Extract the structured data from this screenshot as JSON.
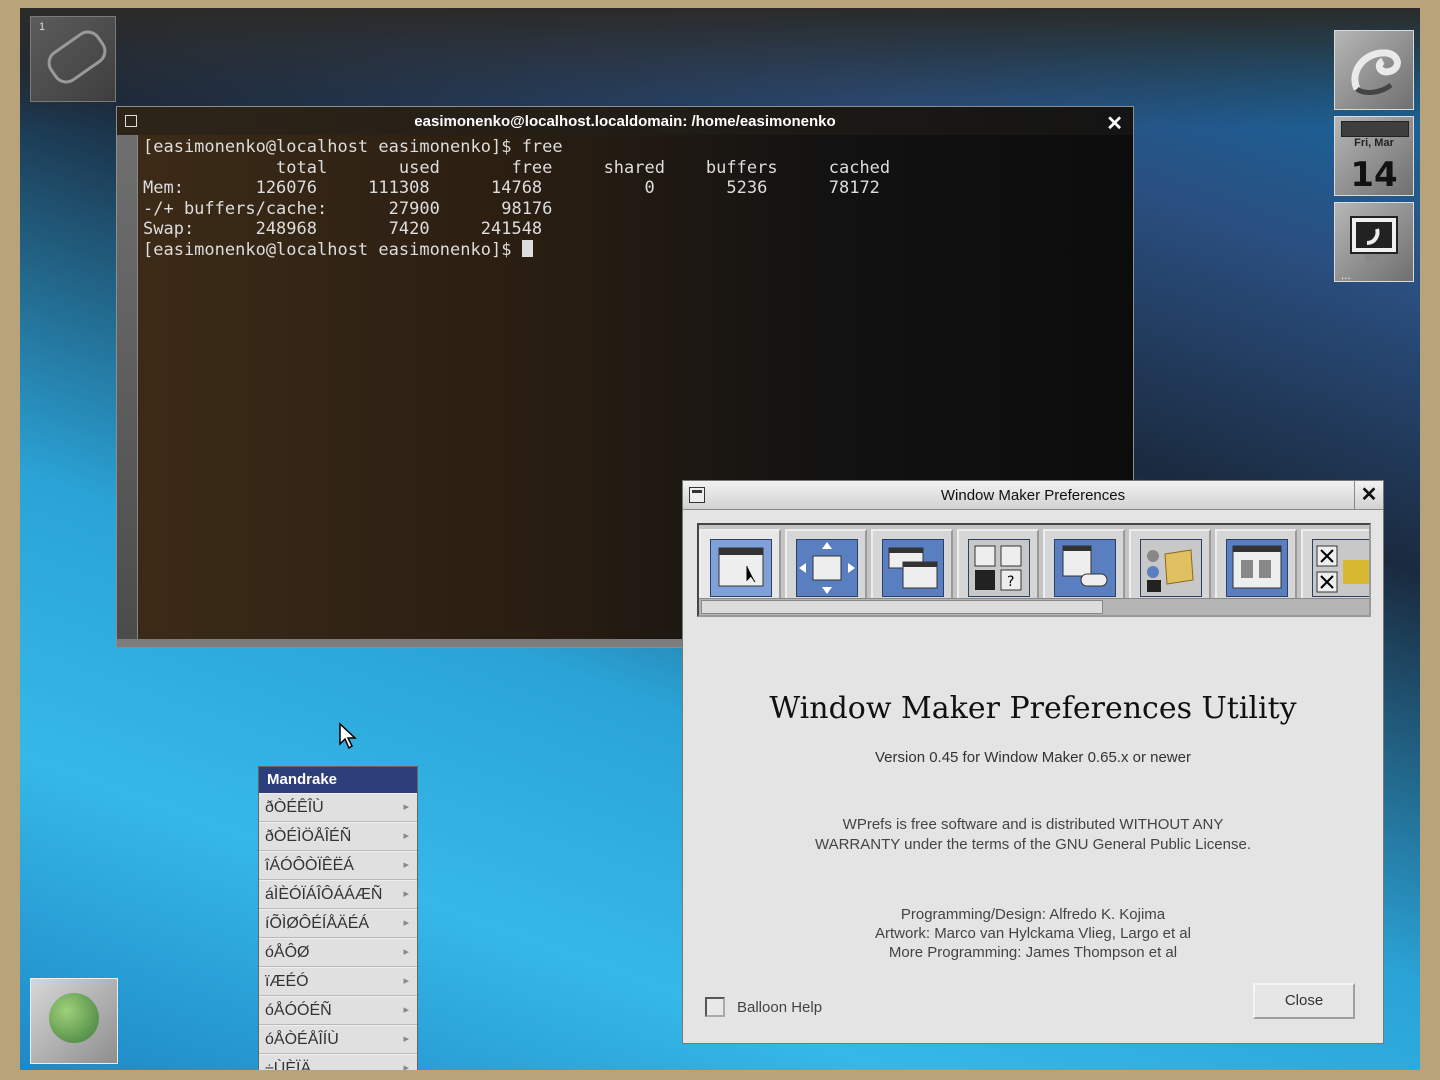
{
  "terminal": {
    "title": "easimonenko@localhost.localdomain: /home/easimonenko",
    "close_label": "✕",
    "lines": [
      "[easimonenko@localhost easimonenko]$ free",
      "             total       used       free     shared    buffers     cached",
      "Mem:       126076     111308      14768          0       5236      78172",
      "-/+ buffers/cache:      27900      98176",
      "Swap:      248968       7420     241548",
      "[easimonenko@localhost easimonenko]$ "
    ]
  },
  "dock": {
    "calendar_day": "Fri, Mar",
    "calendar_date": "14"
  },
  "prefs": {
    "title": "Window Maker Preferences",
    "close_label": "✕",
    "heading": "Window Maker Preferences Utility",
    "version": "Version 0.45 for Window Maker 0.65.x or newer",
    "license_line1": "WPrefs is free software and is distributed WITHOUT ANY",
    "license_line2": "WARRANTY under the terms of the GNU General Public License.",
    "credit1": "Programming/Design: Alfredo K. Kojima",
    "credit2": "Artwork: Marco van Hylckama Vlieg, Largo et al",
    "credit3": "More Programming: James Thompson et al",
    "balloon_help": "Balloon Help",
    "close_button": "Close"
  },
  "menu": {
    "title": "Mandrake",
    "items": [
      "ðÒÉÊÎÙ",
      "ðÒÉÌÖÅÎÉÑ",
      "îÁÓÔÒÏÊËÁ",
      "áÌÈÓÏÁÎÔÁÁÆÑ",
      "íÕÌØÔÉÍÅÄÉÁ",
      "óÅÔØ",
      "ïÆÉÓ",
      "óÅÓÓÉÑ",
      "óÅÒÉÅÎÍÙ",
      "÷ÙÈÏÄ"
    ]
  },
  "colors": {
    "menu_title_bg": "#2c3f7a",
    "term_text": "#dddddd"
  }
}
